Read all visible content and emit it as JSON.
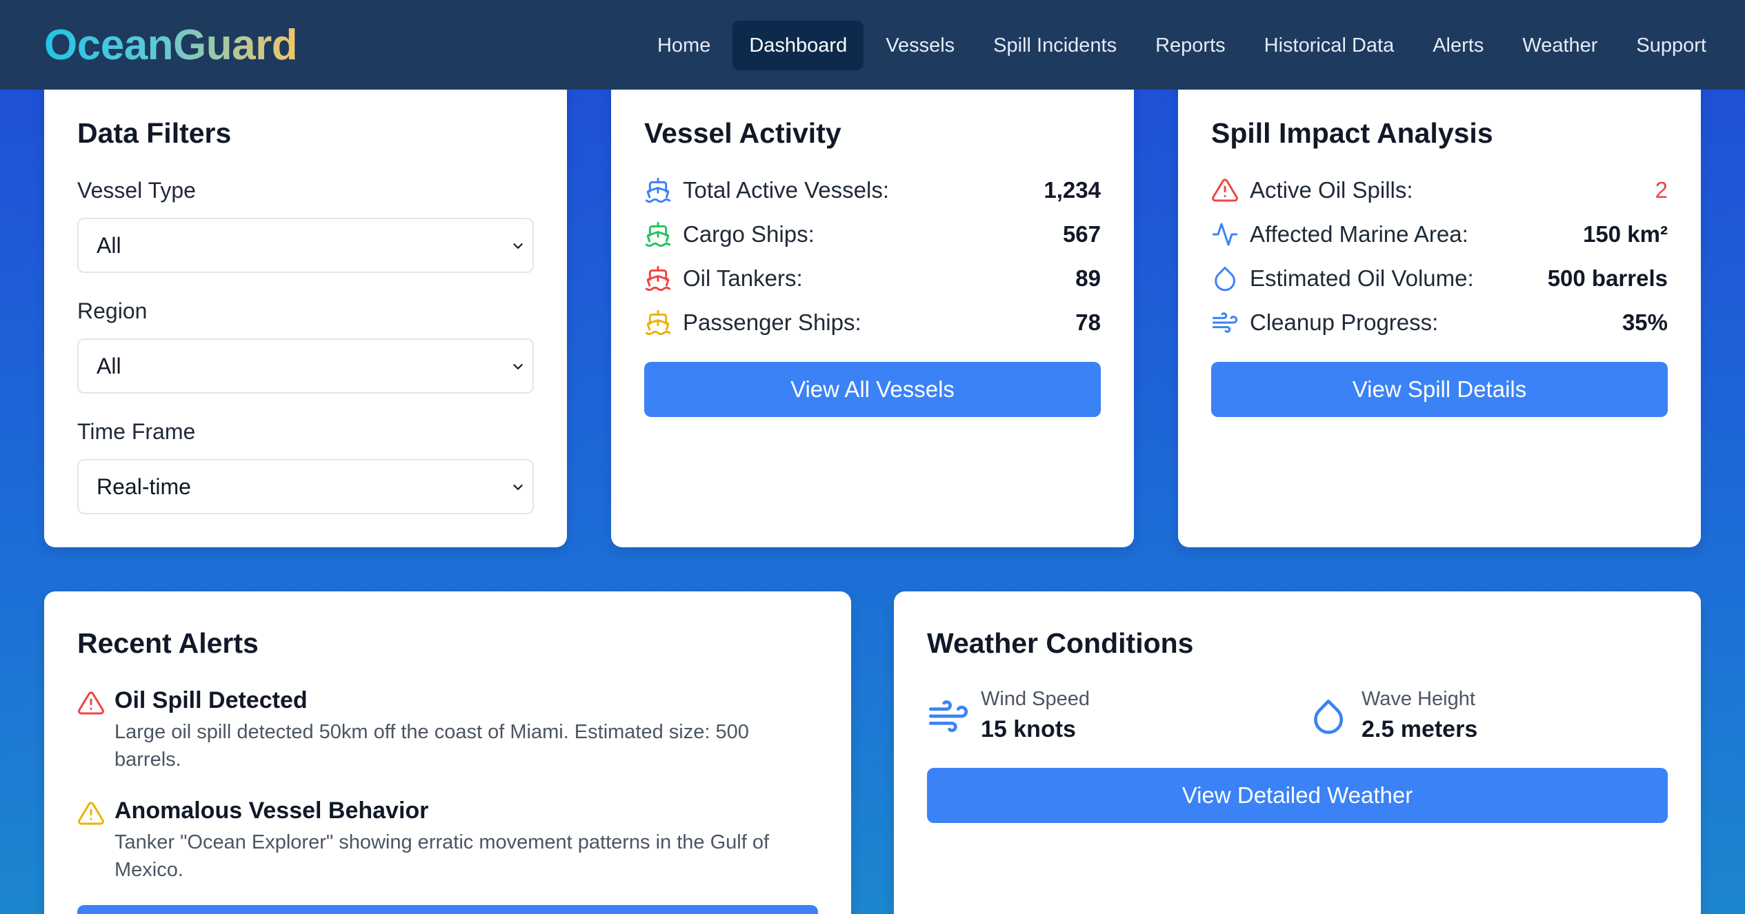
{
  "app": {
    "logo": "OceanGuard"
  },
  "nav": {
    "items": [
      {
        "label": "Home",
        "active": false
      },
      {
        "label": "Dashboard",
        "active": true
      },
      {
        "label": "Vessels",
        "active": false
      },
      {
        "label": "Spill Incidents",
        "active": false
      },
      {
        "label": "Reports",
        "active": false
      },
      {
        "label": "Historical Data",
        "active": false
      },
      {
        "label": "Alerts",
        "active": false
      },
      {
        "label": "Weather",
        "active": false
      },
      {
        "label": "Support",
        "active": false
      }
    ]
  },
  "filters": {
    "title": "Data Filters",
    "vessel_type": {
      "label": "Vessel Type",
      "value": "All"
    },
    "region": {
      "label": "Region",
      "value": "All"
    },
    "time_frame": {
      "label": "Time Frame",
      "value": "Real-time"
    }
  },
  "vessel_activity": {
    "title": "Vessel Activity",
    "rows": [
      {
        "label": "Total Active Vessels:",
        "value": "1,234",
        "icon": "ship-icon",
        "color": "#3b82f6"
      },
      {
        "label": "Cargo Ships:",
        "value": "567",
        "icon": "ship-icon",
        "color": "#22c55e"
      },
      {
        "label": "Oil Tankers:",
        "value": "89",
        "icon": "ship-icon",
        "color": "#ef4444"
      },
      {
        "label": "Passenger Ships:",
        "value": "78",
        "icon": "ship-icon",
        "color": "#eab308"
      }
    ],
    "button_label": "View All Vessels"
  },
  "spill_impact": {
    "title": "Spill Impact Analysis",
    "rows": [
      {
        "label": "Active Oil Spills:",
        "value": "2",
        "icon": "warning-triangle-icon",
        "value_color": "#ef4444"
      },
      {
        "label": "Affected Marine Area:",
        "value": "150 km²",
        "icon": "activity-icon"
      },
      {
        "label": "Estimated Oil Volume:",
        "value": "500 barrels",
        "icon": "droplet-icon"
      },
      {
        "label": "Cleanup Progress:",
        "value": "35%",
        "icon": "wind-icon"
      }
    ],
    "button_label": "View Spill Details"
  },
  "alerts": {
    "title": "Recent Alerts",
    "items": [
      {
        "title": "Oil Spill Detected",
        "description": "Large oil spill detected 50km off the coast of Miami. Estimated size: 500 barrels.",
        "icon": "warning-triangle-icon",
        "color": "#ef4444"
      },
      {
        "title": "Anomalous Vessel Behavior",
        "description": "Tanker \"Ocean Explorer\" showing erratic movement patterns in the Gulf of Mexico.",
        "icon": "warning-triangle-icon",
        "color": "#eab308"
      }
    ]
  },
  "weather": {
    "title": "Weather Conditions",
    "wind": {
      "label": "Wind Speed",
      "value": "15 knots",
      "icon": "wind-icon"
    },
    "wave": {
      "label": "Wave Height",
      "value": "2.5 meters",
      "icon": "droplet-icon"
    },
    "button_label": "View Detailed Weather"
  },
  "colors": {
    "nav_bg": "#1e3a5f",
    "nav_active_bg": "#0d2a4c",
    "button_bg": "#3b82f6",
    "danger": "#ef4444",
    "warning": "#eab308",
    "accent_blue": "#3b82f6"
  }
}
